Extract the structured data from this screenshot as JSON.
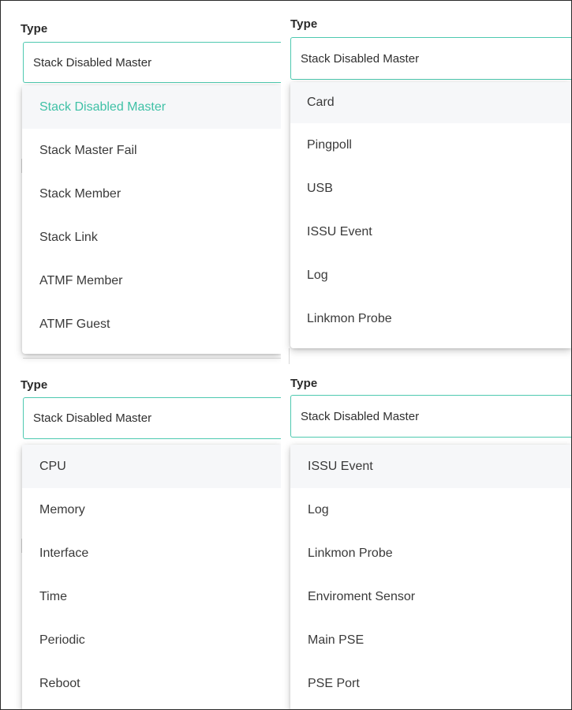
{
  "panels": {
    "top_left": {
      "label": "Type",
      "selected_value": "Stack Disabled Master",
      "options": [
        "Stack Disabled Master",
        "Stack Master Fail",
        "Stack Member",
        "Stack Link",
        "ATMF Member",
        "ATMF Guest"
      ]
    },
    "top_right": {
      "label": "Type",
      "selected_value": "Stack Disabled Master",
      "options": [
        "Card",
        "Pingpoll",
        "USB",
        "ISSU Event",
        "Log",
        "Linkmon Probe"
      ]
    },
    "bottom_left": {
      "label": "Type",
      "selected_value": "Stack Disabled Master",
      "options": [
        "CPU",
        "Memory",
        "Interface",
        "Time",
        "Periodic",
        "Reboot"
      ]
    },
    "bottom_right": {
      "label": "Type",
      "selected_value": "Stack Disabled Master",
      "options": [
        "ISSU Event",
        "Log",
        "Linkmon Probe",
        "Enviroment Sensor",
        "Main PSE",
        "PSE Port"
      ]
    }
  },
  "colors": {
    "accent": "#4ec9b0",
    "selected_text": "#3fc1a6",
    "hover_bg": "#f6f7f9"
  }
}
